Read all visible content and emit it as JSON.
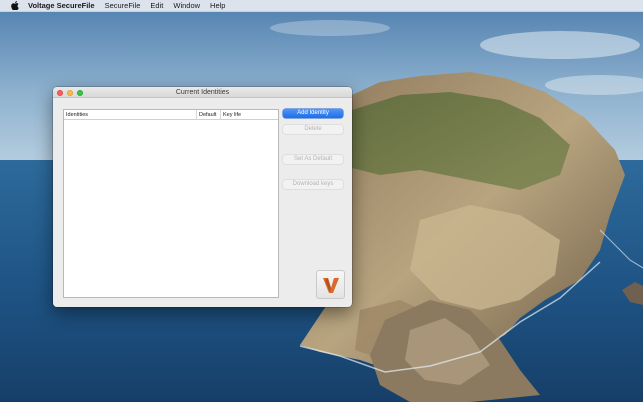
{
  "menubar": {
    "apple_icon": "apple-logo-icon",
    "app_name": "Voltage SecureFile",
    "items": [
      "SecureFile",
      "Edit",
      "Window",
      "Help"
    ]
  },
  "window": {
    "title": "Current Identities",
    "table": {
      "columns": [
        "Identities",
        "Default",
        "Key life"
      ],
      "rows": []
    },
    "buttons": {
      "add_identity": "Add Identity",
      "delete": "Delete",
      "set_as_default": "Set As Default",
      "download_keys": "Download keys"
    },
    "logo_icon": "voltage-v-logo-icon"
  },
  "colors": {
    "accent": "#2a7cf2",
    "logo_orange": "#d9692b",
    "close": "#fc605c",
    "minimize": "#fdbc40",
    "maximize": "#34c84a"
  }
}
